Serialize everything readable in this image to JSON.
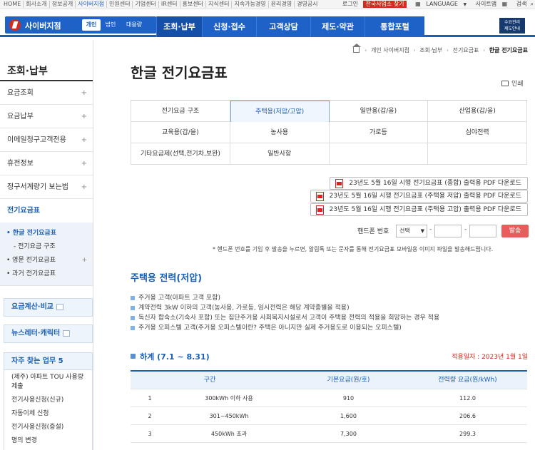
{
  "topbar": {
    "links": [
      "HOME",
      "회사소개",
      "정보공개",
      "사이버지점",
      "민원센터",
      "기업센터",
      "IR센터",
      "홍보센터",
      "지식센터",
      "지속가능경영",
      "윤리경영",
      "경영공시"
    ],
    "active_link": "사이버지점",
    "login": "로그인",
    "find_office": "전국사업소 찾기",
    "language": "LANGUAGE",
    "sitemap": "사이트맵",
    "search": "검색"
  },
  "header": {
    "logo": "사이버지점",
    "segments": [
      "개인",
      "법인",
      "대용량"
    ],
    "gnb": [
      "조회·납부",
      "신청·접수",
      "고객상담",
      "제도·약관",
      "통합포털"
    ],
    "gnb_active": "조회·납부",
    "brand_box": [
      "수요관리",
      "제도안내"
    ]
  },
  "sidebar": {
    "title": "조회·납부",
    "items": [
      {
        "label": "요금조회",
        "plus": "+"
      },
      {
        "label": "요금납부",
        "plus": "+"
      },
      {
        "label": "이메일청구고객전용",
        "plus": "+"
      },
      {
        "label": "휴전정보",
        "plus": "+"
      },
      {
        "label": "정구서계량기 보는법",
        "plus": "+"
      }
    ],
    "current": "전기요금표",
    "sub": [
      {
        "label": "• 한글 전기요금표",
        "cls": "on"
      },
      {
        "label": "- 전기요금 구조",
        "cls": "deep"
      },
      {
        "label": "• 영문 전기요금표",
        "plus": "+"
      },
      {
        "label": "• 과거 전기요금표"
      }
    ],
    "calc_box": "요금계산·비교",
    "news_box": "뉴스레터·캐릭터",
    "freq_title": "자주 찾는 업무 5",
    "freq": [
      "(제주) 아파트 TOU 사용량 제출",
      "전기사용신청(신규)",
      "자동이체 신청",
      "전기사용신청(증설)",
      "명의 변경"
    ]
  },
  "breadcrumb": [
    "개인 사이버지점",
    "조회·납부",
    "전기요금표",
    "한글 전기요금표"
  ],
  "page_title": "한글 전기요금표",
  "print_label": "인쇄",
  "tabs": [
    [
      "전기요금 구조",
      "주택용(저압/고압)",
      "일반용(갑/을)",
      "산업용(갑/을)"
    ],
    [
      "교육용(갑/을)",
      "농사용",
      "가로등",
      "심야전력"
    ],
    [
      "기타요금제(선택,전기차,보완)",
      "일반사항",
      "",
      ""
    ]
  ],
  "tab_active": "주택용(저압/고압)",
  "downloads": [
    "23년도 5월 16일 시행 전기요금표 (종합) 출력용 PDF 다운로드",
    "23년도 5월 16일 시행 전기요금표 (주택용 저압) 출력용 PDF 다운로드",
    "23년도 5월 16일 시행 전기요금표 (주택용 고압) 출력용 PDF 다운로드"
  ],
  "phone": {
    "label": "핸드폰 번호",
    "select_value": "선택",
    "dash": "-",
    "send": "발송"
  },
  "note": "* 핸드폰 번호를 기입 후 발송을 누르면, 알림톡 또는 문자를 통해 전기요금표 모바일용 이미지 파일을 발송해드립니다.",
  "section_title": "주택용 전력(저압)",
  "bullets": [
    "주거용 고객(아파트 고객 포함)",
    "계약전력 3kW 이하의 고객(농사용, 가로등, 임시전력은 해당 계약종별을 적용)",
    "독신자 합숙소(기숙사 포함) 또는 집단주거용 사회복지시설로서 고객이 주택용 전력의 적용을 희망하는 경우 적용",
    "주거용 오피스텔 고객(주거용 오피스텔이란? 주택은 아니지만 실제 주거용도로 이용되는 오피스텔)"
  ],
  "sub_title": "하계 (7.1 ~ 8.31)",
  "apply_date": "적용일자 : 2023년 1월 1일",
  "table": {
    "headers": [
      "구간",
      "기본요금(원/호)",
      "전력량 요금(원/kWh)"
    ],
    "rows": [
      [
        "1",
        "300kWh 이하 사용",
        "910",
        "112.0"
      ],
      [
        "2",
        "301~450kWh",
        "1,600",
        "206.6"
      ],
      [
        "3",
        "450kWh 초과",
        "7,300",
        "299.3"
      ]
    ]
  }
}
